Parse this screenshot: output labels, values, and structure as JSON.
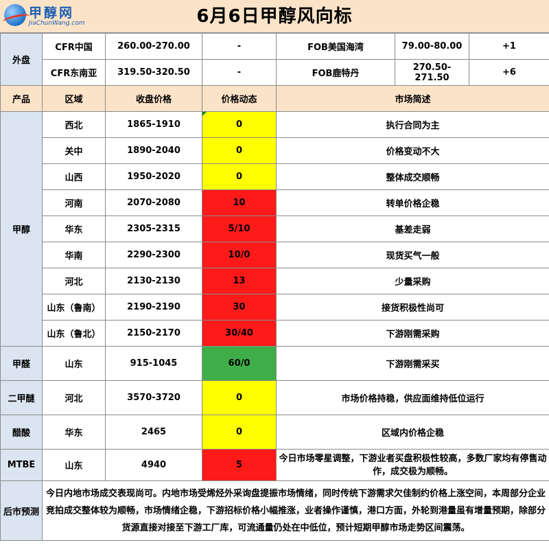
{
  "title": "6月6日甲醇风向标",
  "logo": {
    "cn": "甲醇网",
    "en": "JiaChunWang.com"
  },
  "external": {
    "label": "外盘",
    "rows": [
      {
        "name_a": "CFR中国",
        "price_a": "260.00-270.00",
        "change_a": "-",
        "name_b": "FOB美国海湾",
        "price_b": "79.00-80.00",
        "change_b": "+1"
      },
      {
        "name_a": "CFR东南亚",
        "price_a": "319.50-320.50",
        "change_a": "-",
        "name_b": "FOB鹿特丹",
        "price_b": "270.50-271.50",
        "change_b": "+6"
      }
    ]
  },
  "headers": {
    "product": "产品",
    "region": "区域",
    "close": "收盘价格",
    "dynamic": "价格动态",
    "market": "市场简述"
  },
  "methanol": {
    "label": "甲醇",
    "rows": [
      {
        "region": "西北",
        "price": "1865-1910",
        "change": "0",
        "note": "执行合同为主",
        "color": "#ffff00"
      },
      {
        "region": "关中",
        "price": "1890-2040",
        "change": "0",
        "note": "价格变动不大",
        "color": "#ffff00"
      },
      {
        "region": "山西",
        "price": "1950-2020",
        "change": "0",
        "note": "整体成交顺畅",
        "color": "#ffff00"
      },
      {
        "region": "河南",
        "price": "2070-2080",
        "change": "10",
        "note": "转单价格企稳",
        "color": "#ff1a1a"
      },
      {
        "region": "华东",
        "price": "2305-2315",
        "change": "5/10",
        "note": "基差走弱",
        "color": "#ff1a1a"
      },
      {
        "region": "华南",
        "price": "2290-2300",
        "change": "10/0",
        "note": "现货买气一般",
        "color": "#ff1a1a"
      },
      {
        "region": "河北",
        "price": "2130-2130",
        "change": "13",
        "note": "少量采购",
        "color": "#ff1a1a"
      },
      {
        "region": "山东（鲁南）",
        "price": "2190-2190",
        "change": "30",
        "note": "接货积极性尚可",
        "color": "#ff1a1a"
      },
      {
        "region": "山东（鲁北）",
        "price": "2150-2170",
        "change": "30/40",
        "note": "下游刚需采购",
        "color": "#ff1a1a"
      }
    ]
  },
  "others": [
    {
      "product": "甲醛",
      "region": "山东",
      "price": "915-1045",
      "change": "60/0",
      "note": "下游刚需采买",
      "color": "#3fae49"
    },
    {
      "product": "二甲醚",
      "region": "河北",
      "price": "3570-3720",
      "change": "0",
      "note": "市场价格持稳，供应面维持低位运行",
      "color": "#ffff00"
    },
    {
      "product": "醋酸",
      "region": "华东",
      "price": "2465",
      "change": "0",
      "note": "区域内价格企稳",
      "color": "#ffff00"
    },
    {
      "product": "MTBE",
      "region": "山东",
      "price": "4940",
      "change": "5",
      "note": "今日市场零星调整，下游业者买盘积极性较高，多数厂家均有停售动作，成交极为顺畅。",
      "color": "#ff1a1a"
    }
  ],
  "forecast": {
    "label": "后市预测",
    "text": "今日内地市场成交表现尚可。内地市场受烯烃外采询盘提振市场情绪，同时传统下游需求欠佳制约价格上涨空间，本周部分企业竞拍成交整体较为顺畅，市场情绪企稳，下游招标价格小幅推涨，业者操作谨慎，港口方面，外轮到港量虽有增量预期，除部分货源直接对接至下游工厂库，可流通量仍处在中低位，预计短期甲醇市场走势区间震荡。"
  }
}
